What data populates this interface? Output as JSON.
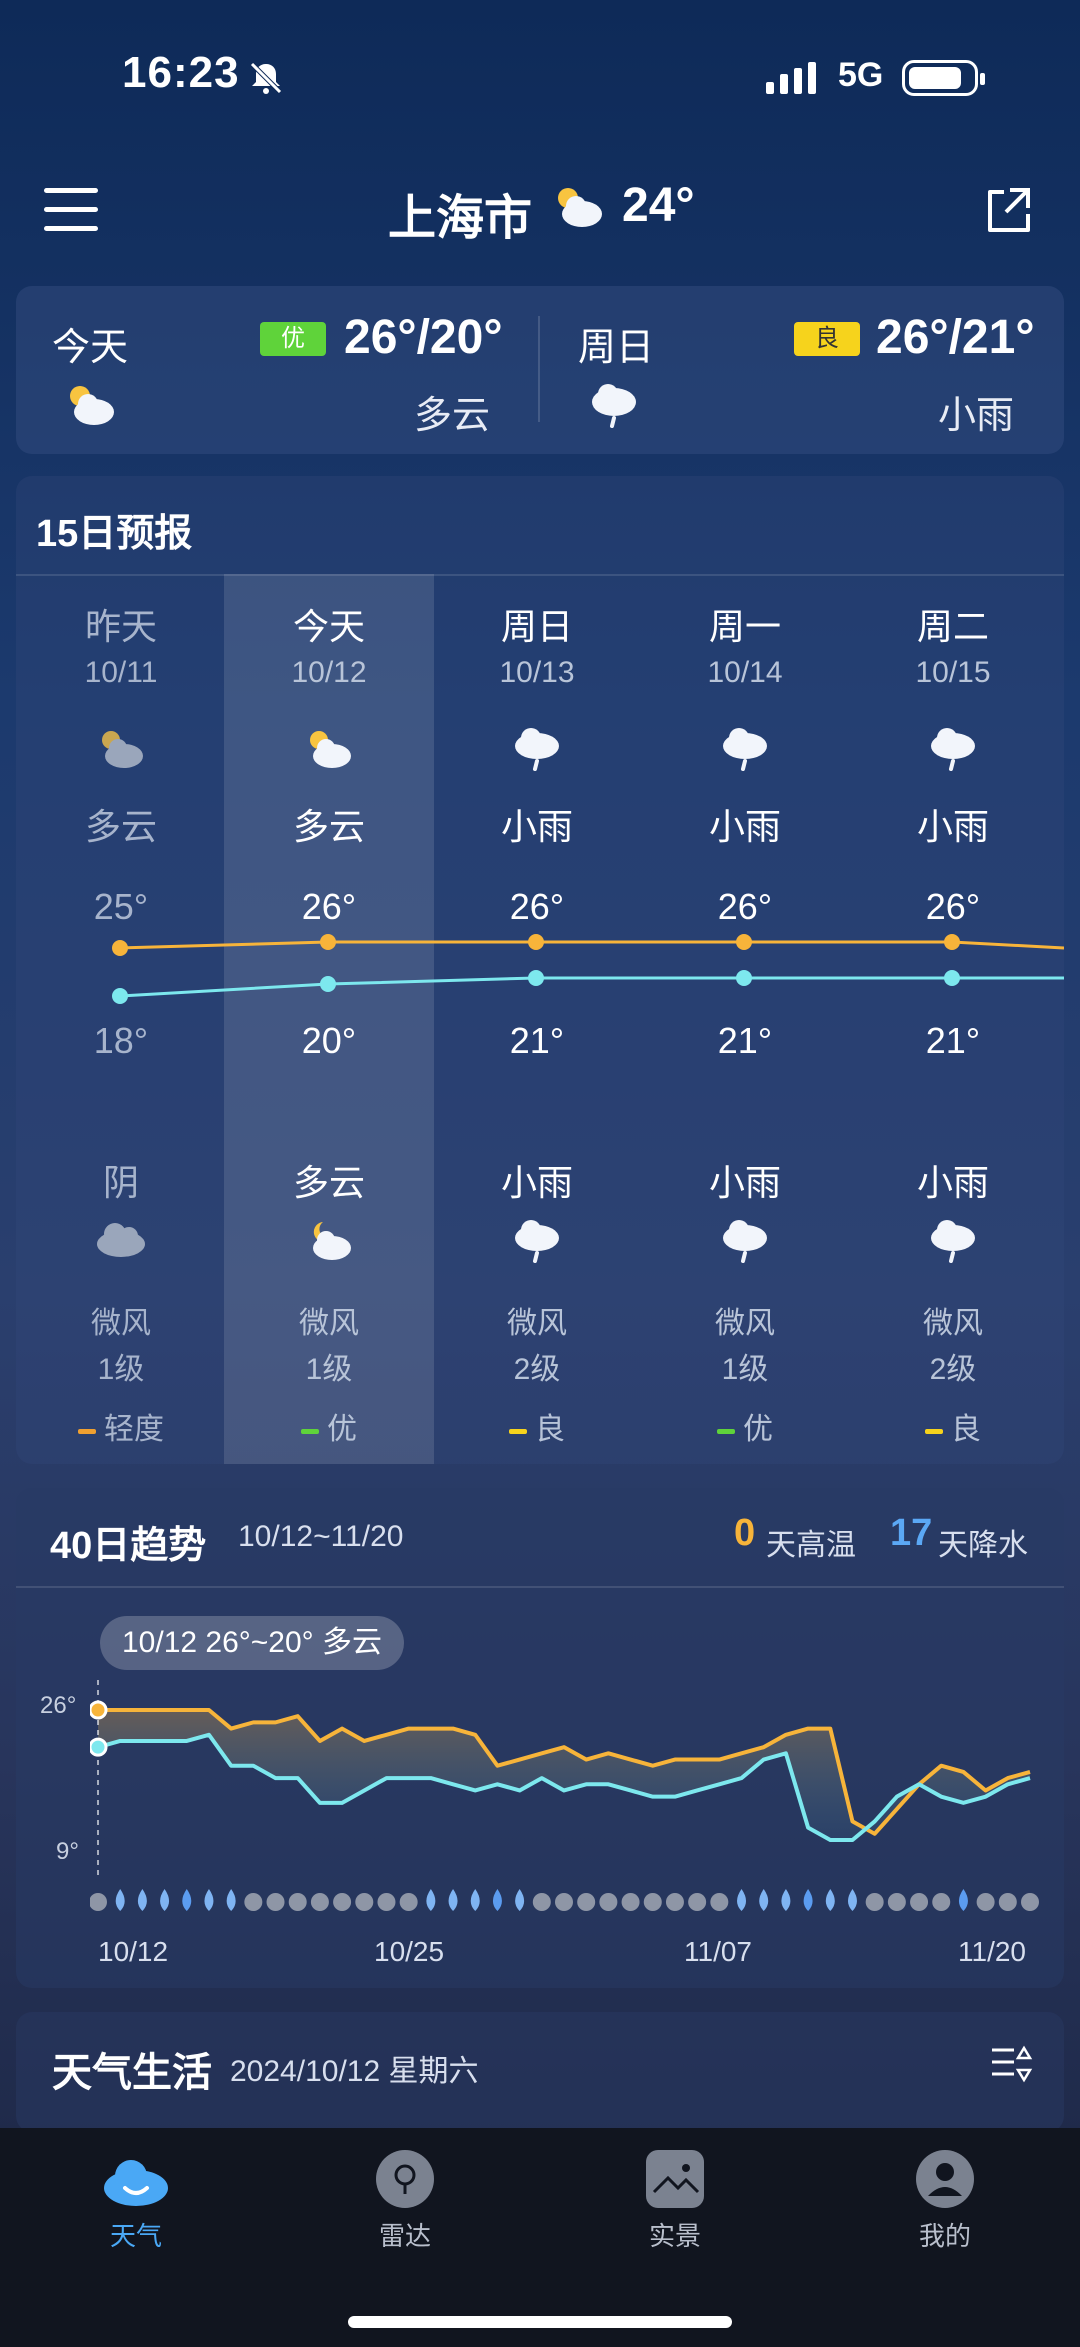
{
  "status": {
    "time": "16:23",
    "network": "5G"
  },
  "header": {
    "city": "上海市",
    "temp": "24°",
    "icon": "partly-cloudy-icon"
  },
  "summary": [
    {
      "day": "今天",
      "aqi": "优",
      "aqi_color": "#5fd33a",
      "temp": "26°/20°",
      "desc": "多云",
      "icon": "partly-cloudy-icon"
    },
    {
      "day": "周日",
      "aqi": "良",
      "aqi_color": "#f6d31c",
      "temp": "26°/21°",
      "desc": "小雨",
      "icon": "light-rain-icon"
    }
  ],
  "forecast15": {
    "title": "15日预报",
    "days": [
      {
        "name": "昨天",
        "date": "10/11",
        "day_desc": "多云",
        "high": "25°",
        "low": "18°",
        "night_desc": "阴",
        "wind": "微风",
        "level": "1级",
        "aqi": "轻度",
        "aqi_color": "#f0a030",
        "dim": true
      },
      {
        "name": "今天",
        "date": "10/12",
        "day_desc": "多云",
        "high": "26°",
        "low": "20°",
        "night_desc": "多云",
        "wind": "微风",
        "level": "1级",
        "aqi": "优",
        "aqi_color": "#5fd33a",
        "dim": false
      },
      {
        "name": "周日",
        "date": "10/13",
        "day_desc": "小雨",
        "high": "26°",
        "low": "21°",
        "night_desc": "小雨",
        "wind": "微风",
        "level": "2级",
        "aqi": "良",
        "aqi_color": "#f6d31c",
        "dim": false
      },
      {
        "name": "周一",
        "date": "10/14",
        "day_desc": "小雨",
        "high": "26°",
        "low": "21°",
        "night_desc": "小雨",
        "wind": "微风",
        "level": "1级",
        "aqi": "优",
        "aqi_color": "#5fd33a",
        "dim": false
      },
      {
        "name": "周二",
        "date": "10/15",
        "day_desc": "小雨",
        "high": "26°",
        "low": "21°",
        "night_desc": "小雨",
        "wind": "微风",
        "level": "2级",
        "aqi": "良",
        "aqi_color": "#f6d31c",
        "dim": false
      }
    ]
  },
  "trend40": {
    "title": "40日趋势",
    "range": "10/12~11/20",
    "hot_days": "0",
    "hot_label": "天高温",
    "rain_days": "17",
    "rain_label": "天降水",
    "tooltip": "10/12 26°~20° 多云",
    "y_high_label": "26°",
    "y_low_label": "9°",
    "x_labels": [
      "10/12",
      "10/25",
      "11/07",
      "11/20"
    ],
    "colors": {
      "high": "#f7b43a",
      "low": "#7de8ee",
      "rain": "#5b9cf0",
      "dry": "#8e96a6"
    }
  },
  "life": {
    "title": "天气生活",
    "date": "2024/10/12 星期六"
  },
  "tabs": [
    {
      "label": "天气",
      "icon": "weather-icon",
      "active": true
    },
    {
      "label": "雷达",
      "icon": "radar-icon",
      "active": false
    },
    {
      "label": "实景",
      "icon": "scene-icon",
      "active": false
    },
    {
      "label": "我的",
      "icon": "profile-icon",
      "active": false
    }
  ],
  "chart_data": {
    "type": "area",
    "x_start": "10/12",
    "x_end": "11/20",
    "series": [
      {
        "name": "high",
        "values": [
          26,
          26,
          26,
          26,
          26,
          26,
          23,
          24,
          24,
          25,
          21,
          23,
          21,
          22,
          23,
          23,
          23,
          22,
          17,
          18,
          19,
          20,
          18,
          19,
          18,
          17,
          18,
          18,
          18,
          19,
          20,
          22,
          23,
          23,
          8,
          6,
          10,
          14,
          17,
          16,
          13,
          15,
          16
        ]
      },
      {
        "name": "low",
        "values": [
          20,
          21,
          21,
          21,
          21,
          22,
          17,
          17,
          15,
          15,
          11,
          11,
          13,
          15,
          15,
          15,
          14,
          13,
          14,
          13,
          15,
          13,
          14,
          14,
          13,
          12,
          12,
          13,
          14,
          15,
          18,
          19,
          7,
          5,
          5,
          8,
          12,
          14,
          12,
          11,
          12,
          14,
          15
        ]
      }
    ],
    "rain_days": [
      0,
      1,
      1,
      1,
      1,
      1,
      1,
      0,
      0,
      0,
      0,
      0,
      0,
      0,
      0,
      1,
      1,
      1,
      1,
      1,
      0,
      0,
      0,
      0,
      0,
      0,
      0,
      0,
      0,
      1,
      1,
      1,
      1,
      1,
      1,
      0,
      0,
      0,
      0,
      1,
      0,
      0,
      0
    ]
  }
}
